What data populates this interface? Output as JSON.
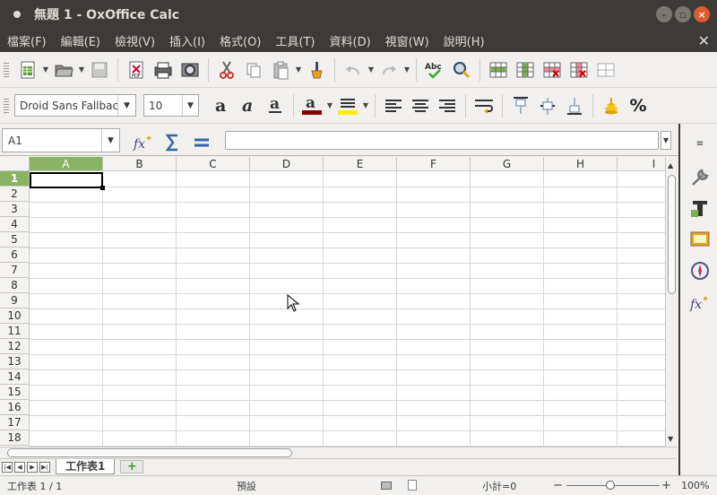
{
  "window": {
    "title": "無題 1 - OxOffice Calc"
  },
  "menu": [
    "檔案(F)",
    "編輯(E)",
    "檢視(V)",
    "插入(I)",
    "格式(O)",
    "工具(T)",
    "資料(D)",
    "視窗(W)",
    "說明(H)"
  ],
  "format_bar": {
    "font_name": "Droid Sans Fallback",
    "font_size": "10",
    "percent_label": "%"
  },
  "formula_bar": {
    "cell_ref": "A1",
    "formula": ""
  },
  "grid": {
    "columns": [
      "A",
      "B",
      "C",
      "D",
      "E",
      "F",
      "G",
      "H",
      "I"
    ],
    "rows": [
      "1",
      "2",
      "3",
      "4",
      "5",
      "6",
      "7",
      "8",
      "9",
      "10",
      "11",
      "12",
      "13",
      "14",
      "15",
      "16",
      "17",
      "18"
    ],
    "selected_column": "A",
    "selected_row": "1"
  },
  "sheets": {
    "tabs": [
      "工作表1"
    ],
    "add_label": "+"
  },
  "status": {
    "sheet_info": "工作表 1 / 1",
    "page_style": "預設",
    "sum": "小計=0",
    "zoom": "100%",
    "zoom_minus": "−",
    "zoom_plus": "+"
  },
  "colors": {
    "accent_green": "#8ab264",
    "titlebar": "#3c3b37",
    "close": "#e1572f"
  }
}
